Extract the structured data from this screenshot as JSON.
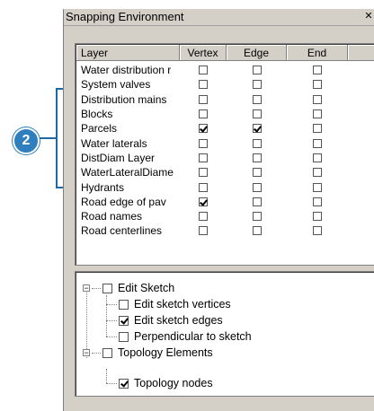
{
  "callout": {
    "number": "2",
    "color": "#2f7fbf"
  },
  "window": {
    "title": "Snapping Environment",
    "close_glyph": "✕"
  },
  "table": {
    "headers": {
      "layer": "Layer",
      "vertex": "Vertex",
      "edge": "Edge",
      "end": "End"
    },
    "rows": [
      {
        "name": "Water distribution r",
        "vertex": false,
        "edge": false,
        "end": false
      },
      {
        "name": "System valves",
        "vertex": false,
        "edge": false,
        "end": false
      },
      {
        "name": "Distribution mains",
        "vertex": false,
        "edge": false,
        "end": false
      },
      {
        "name": "Blocks",
        "vertex": false,
        "edge": false,
        "end": false
      },
      {
        "name": "Parcels",
        "vertex": true,
        "edge": true,
        "end": false
      },
      {
        "name": "Water laterals",
        "vertex": false,
        "edge": false,
        "end": false
      },
      {
        "name": "DistDiam Layer",
        "vertex": false,
        "edge": false,
        "end": false
      },
      {
        "name": "WaterLateralDiame",
        "vertex": false,
        "edge": false,
        "end": false
      },
      {
        "name": "Hydrants",
        "vertex": false,
        "edge": false,
        "end": false
      },
      {
        "name": "Road  edge of pav",
        "vertex": true,
        "edge": false,
        "end": false
      },
      {
        "name": "Road names",
        "vertex": false,
        "edge": false,
        "end": false
      },
      {
        "name": "Road centerlines",
        "vertex": false,
        "edge": false,
        "end": false
      }
    ]
  },
  "tree": {
    "edit_sketch": {
      "label": "Edit Sketch",
      "expander": "−",
      "checked": false
    },
    "edit_sketch_vertices": {
      "label": "Edit sketch vertices",
      "checked": false
    },
    "edit_sketch_edges": {
      "label": "Edit sketch edges",
      "checked": true
    },
    "perpendicular": {
      "label": "Perpendicular to sketch",
      "checked": false
    },
    "topology_elements": {
      "label": "Topology Elements",
      "expander": "−",
      "checked": false
    },
    "topology_nodes": {
      "label": "Topology nodes",
      "checked": true
    }
  }
}
